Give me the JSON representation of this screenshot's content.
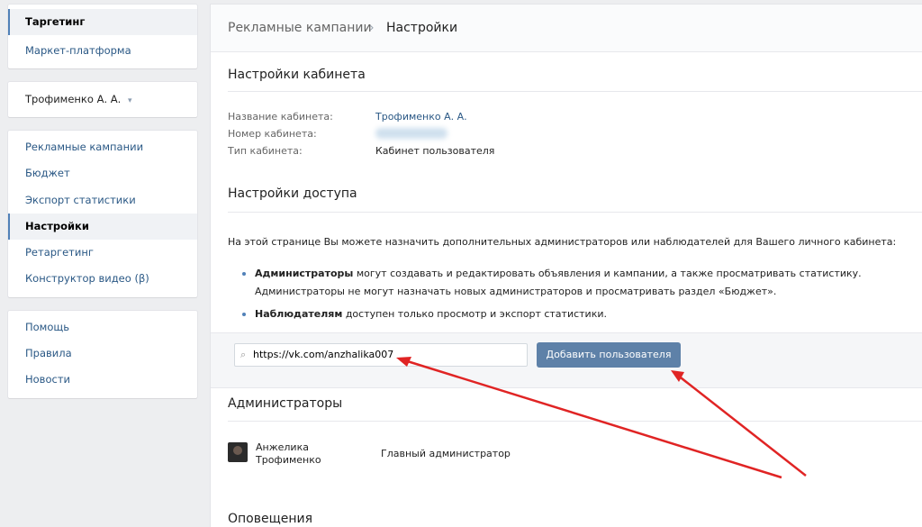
{
  "sidebar": {
    "group1": [
      {
        "label": "Таргетинг",
        "active": true
      },
      {
        "label": "Маркет-платформа",
        "active": false
      }
    ],
    "account": {
      "label": "Трофименко А. А.",
      "chevron": "▾"
    },
    "group2": [
      {
        "label": "Рекламные кампании",
        "active": false
      },
      {
        "label": "Бюджет",
        "active": false
      },
      {
        "label": "Экспорт статистики",
        "active": false
      },
      {
        "label": "Настройки",
        "active": true
      },
      {
        "label": "Ретаргетинг",
        "active": false
      },
      {
        "label": "Конструктор видео (β)",
        "active": false
      }
    ],
    "group3": [
      {
        "label": "Помощь"
      },
      {
        "label": "Правила"
      },
      {
        "label": "Новости"
      }
    ]
  },
  "breadcrumb": {
    "parent": "Рекламные кампании",
    "separator": "›",
    "current": "Настройки"
  },
  "cabinet_settings": {
    "title": "Настройки кабинета",
    "name_label": "Название кабинета:",
    "name_value": "Трофименко А. А.",
    "number_label": "Номер кабинета:",
    "type_label": "Тип кабинета:",
    "type_value": "Кабинет пользователя"
  },
  "access_settings": {
    "title": "Настройки доступа",
    "intro": "На этой странице Вы можете назначить дополнительных администраторов или наблюдателей для Вашего личного кабинета:",
    "admins_bold": "Администраторы",
    "admins_text1": " могут создавать и редактировать объявления и кампании, а также просматривать статистику.",
    "admins_text2": "Администраторы не могут назначать новых администраторов и просматривать раздел «Бюджет».",
    "observers_bold": "Наблюдателям",
    "observers_text": " доступен только просмотр и экспорт статистики."
  },
  "add_user": {
    "input_value": "https://vk.com/anzhalika007",
    "button_label": "Добавить пользователя"
  },
  "administrators": {
    "title": "Администраторы",
    "items": [
      {
        "name_line1": "Анжелика",
        "name_line2": "Трофименко",
        "role": "Главный администратор"
      }
    ]
  },
  "next_section_title": "Оповещения",
  "colors": {
    "accent": "#5181b8",
    "button": "#5e81a8",
    "link": "#2a5885",
    "arrow": "#e02424"
  },
  "icons": {
    "search": "search-icon",
    "chevron": "chevron-down-icon"
  }
}
